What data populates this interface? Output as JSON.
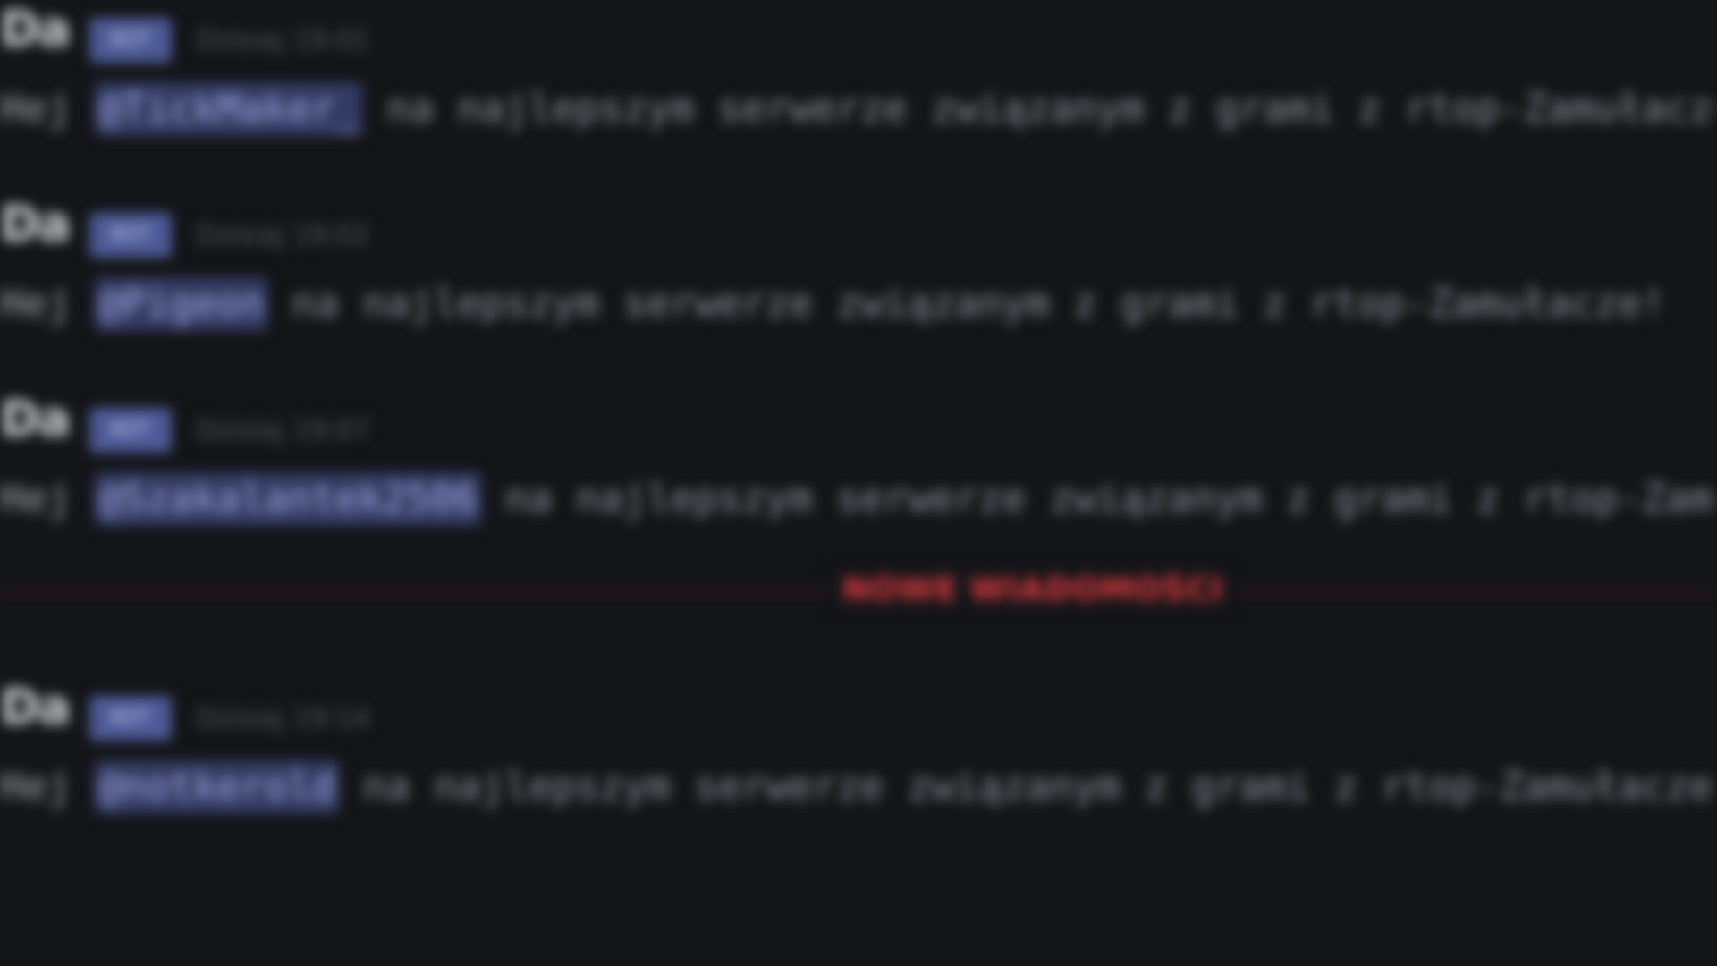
{
  "messages": [
    {
      "author": "Da",
      "tag": "BOT",
      "timestamp": "Dzisiaj 19:01",
      "prefix": "Hej",
      "mention": "@TickMaker_",
      "text": "na najlepszym serwerze związanym z grami z rtop-Zamułacze!"
    },
    {
      "author": "Da",
      "tag": "BOT",
      "timestamp": "Dzisiaj 19:02",
      "prefix": "Hej",
      "mention": "@Pigeon",
      "text": "na najlepszym serwerze związanym z grami z rtop-Zamułacze!"
    },
    {
      "author": "Da",
      "tag": "BOT",
      "timestamp": "Dzisiaj 19:07",
      "prefix": "Hej",
      "mention": "@Szakalantek2506",
      "text": "na najlepszym serwerze związanym z grami z rtop-Zamułacze!"
    },
    {
      "author": "Da",
      "tag": "BOT",
      "timestamp": "Dzisiaj 19:14",
      "prefix": "Hej",
      "mention": "@notkerold",
      "text": "na najlepszym serwerze związanym z grami z rtop-Zamułacze!"
    }
  ],
  "divider": {
    "label": "NOWE WIADOMOŚCI"
  }
}
